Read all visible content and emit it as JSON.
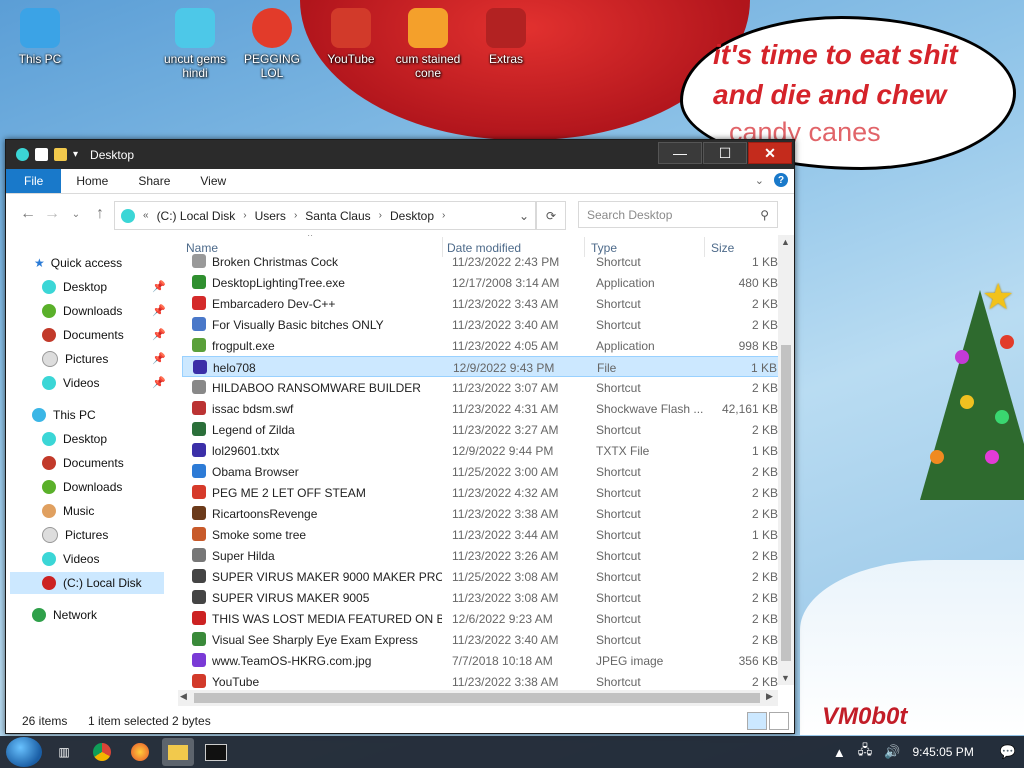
{
  "desktop": {
    "icons": [
      {
        "label": "This PC",
        "color": "#3ba3e6"
      },
      {
        "label": "uncut gems hindi",
        "color": "#4dc8e8"
      },
      {
        "label": "PEGGING LOL",
        "color": "#e23b2a"
      },
      {
        "label": "YouTube",
        "color": "#d23a2a"
      },
      {
        "label": "cum stained cone",
        "color": "#f4a02b"
      },
      {
        "label": "Extras",
        "color": "#b22222"
      }
    ],
    "speech": {
      "line1": "it's time to eat shit",
      "line2": "and die and chew",
      "line3": "candy canes"
    },
    "watermark": "VM0b0t"
  },
  "window": {
    "title": "Desktop",
    "ribbon": {
      "tabs": [
        "File",
        "Home",
        "Share",
        "View"
      ]
    },
    "address": {
      "crumbs": [
        "(C:) Local Disk",
        "Users",
        "Santa Claus",
        "Desktop"
      ],
      "prefix": "«"
    },
    "search": {
      "placeholder": "Search Desktop"
    },
    "nav": {
      "quick_access": "Quick access",
      "quick_items": [
        "Desktop",
        "Downloads",
        "Documents",
        "Pictures",
        "Videos"
      ],
      "this_pc": "This PC",
      "pc_items": [
        "Desktop",
        "Documents",
        "Downloads",
        "Music",
        "Pictures",
        "Videos",
        "(C:) Local Disk"
      ],
      "network": "Network"
    },
    "columns": {
      "name": "Name",
      "date": "Date modified",
      "type": "Type",
      "size": "Size"
    },
    "files": [
      {
        "name": "Broken Christmas Cock",
        "date": "11/23/2022 2:43 PM",
        "type": "Shortcut",
        "size": "1 KB",
        "color": "#999"
      },
      {
        "name": "DesktopLightingTree.exe",
        "date": "12/17/2008 3:14 AM",
        "type": "Application",
        "size": "480 KB",
        "color": "#2f8f2f"
      },
      {
        "name": "Embarcadero Dev-C++",
        "date": "11/23/2022 3:43 AM",
        "type": "Shortcut",
        "size": "2 KB",
        "color": "#d42a2a"
      },
      {
        "name": "For Visually Basic bitches ONLY",
        "date": "11/23/2022 3:40 AM",
        "type": "Shortcut",
        "size": "2 KB",
        "color": "#4a78c9"
      },
      {
        "name": "frogpult.exe",
        "date": "11/23/2022 4:05 AM",
        "type": "Application",
        "size": "998 KB",
        "color": "#5aa03a"
      },
      {
        "name": "helo708",
        "date": "12/9/2022 9:43 PM",
        "type": "File",
        "size": "1 KB",
        "color": "#3b2fa8"
      },
      {
        "name": "HILDABOO RANSOMWARE BUILDER",
        "date": "11/23/2022 3:07 AM",
        "type": "Shortcut",
        "size": "2 KB",
        "color": "#888"
      },
      {
        "name": "issac bdsm.swf",
        "date": "11/23/2022 4:31 AM",
        "type": "Shockwave Flash ...",
        "size": "42,161 KB",
        "color": "#b33"
      },
      {
        "name": "Legend of Zilda",
        "date": "11/23/2022 3:27 AM",
        "type": "Shortcut",
        "size": "2 KB",
        "color": "#2b6f3a"
      },
      {
        "name": "lol29601.txtx",
        "date": "12/9/2022 9:44 PM",
        "type": "TXTX File",
        "size": "1 KB",
        "color": "#3b2fa8"
      },
      {
        "name": "Obama Browser",
        "date": "11/25/2022 3:00 AM",
        "type": "Shortcut",
        "size": "2 KB",
        "color": "#2d7bd6"
      },
      {
        "name": "PEG ME 2 LET OFF STEAM",
        "date": "11/23/2022 4:32 AM",
        "type": "Shortcut",
        "size": "2 KB",
        "color": "#d63a2a"
      },
      {
        "name": "RicartoonsRevenge",
        "date": "11/23/2022 3:38 AM",
        "type": "Shortcut",
        "size": "2 KB",
        "color": "#6b3a1a"
      },
      {
        "name": "Smoke some tree",
        "date": "11/23/2022 3:44 AM",
        "type": "Shortcut",
        "size": "1 KB",
        "color": "#c85a2a"
      },
      {
        "name": "Super Hilda",
        "date": "11/23/2022 3:26 AM",
        "type": "Shortcut",
        "size": "2 KB",
        "color": "#777"
      },
      {
        "name": "SUPER VIRUS MAKER 9000 MAKER PROT...",
        "date": "11/25/2022 3:08 AM",
        "type": "Shortcut",
        "size": "2 KB",
        "color": "#444"
      },
      {
        "name": "SUPER VIRUS MAKER 9005",
        "date": "11/23/2022 3:08 AM",
        "type": "Shortcut",
        "size": "2 KB",
        "color": "#444"
      },
      {
        "name": "THIS WAS LOST MEDIA FEATURED ON BL...",
        "date": "12/6/2022 9:23 AM",
        "type": "Shortcut",
        "size": "2 KB",
        "color": "#c22"
      },
      {
        "name": "Visual See Sharply Eye Exam Express",
        "date": "11/23/2022 3:40 AM",
        "type": "Shortcut",
        "size": "2 KB",
        "color": "#3a8a3a"
      },
      {
        "name": "www.TeamOS-HKRG.com.jpg",
        "date": "7/7/2018 10:18 AM",
        "type": "JPEG image",
        "size": "356 KB",
        "color": "#7a3ad6"
      },
      {
        "name": "YouTube",
        "date": "11/23/2022 3:38 AM",
        "type": "Shortcut",
        "size": "2 KB",
        "color": "#d23a2a"
      }
    ],
    "selected_index": 5,
    "status": {
      "items": "26 items",
      "selected": "1 item selected",
      "size": "2 bytes"
    }
  },
  "taskbar": {
    "clock": "9:45:05 PM"
  }
}
